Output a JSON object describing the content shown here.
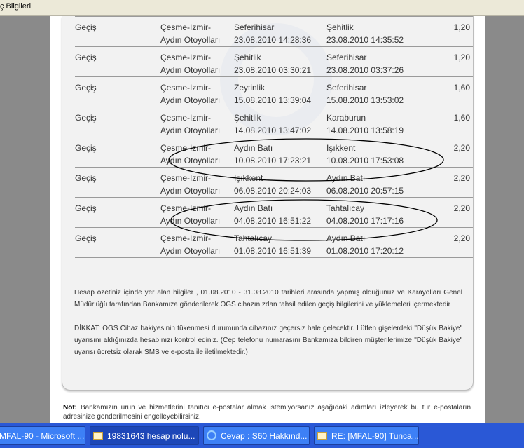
{
  "window": {
    "title": "ç Bilgileri"
  },
  "transactions": [
    {
      "type": "Geçiş",
      "operator_line1": "Çesme-Izmir-",
      "operator_line2": "Aydın Otoyolları",
      "entry_point": "Seferihisar",
      "entry_time": "23.08.2010 14:28:36",
      "exit_point": "Şehitlik",
      "exit_time": "23.08.2010 14:35:52",
      "amount": "1,20"
    },
    {
      "type": "Geçiş",
      "operator_line1": "Çesme-Izmir-",
      "operator_line2": "Aydın Otoyolları",
      "entry_point": "Şehitlik",
      "entry_time": "23.08.2010 03:30:21",
      "exit_point": "Seferihisar",
      "exit_time": "23.08.2010 03:37:26",
      "amount": "1,20"
    },
    {
      "type": "Geçiş",
      "operator_line1": "Çesme-Izmir-",
      "operator_line2": "Aydın Otoyolları",
      "entry_point": "Zeytinlik",
      "entry_time": "15.08.2010 13:39:04",
      "exit_point": "Seferihisar",
      "exit_time": "15.08.2010 13:53:02",
      "amount": "1,60"
    },
    {
      "type": "Geçiş",
      "operator_line1": "Çesme-Izmir-",
      "operator_line2": "Aydın Otoyolları",
      "entry_point": "Şehitlik",
      "entry_time": "14.08.2010 13:47:02",
      "exit_point": "Karaburun",
      "exit_time": "14.08.2010 13:58:19",
      "amount": "1,60"
    },
    {
      "type": "Geçiş",
      "operator_line1": "Çesme-Izmir-",
      "operator_line2": "Aydın Otoyolları",
      "entry_point": "Aydın Batı",
      "entry_time": "10.08.2010 17:23:21",
      "exit_point": "Işıkkent",
      "exit_time": "10.08.2010 17:53:08",
      "amount": "2,20"
    },
    {
      "type": "Geçiş",
      "operator_line1": "Çesme-Izmir-",
      "operator_line2": "Aydın Otoyolları",
      "entry_point": "Işıkkent",
      "entry_time": "06.08.2010 20:24:03",
      "exit_point": "Aydın Batı",
      "exit_time": "06.08.2010 20:57:15",
      "amount": "2,20"
    },
    {
      "type": "Geçiş",
      "operator_line1": "Çesme-Izmir-",
      "operator_line2": "Aydın Otoyolları",
      "entry_point": "Aydın Batı",
      "entry_time": "04.08.2010 16:51:22",
      "exit_point": "Tahtalıcay",
      "exit_time": "04.08.2010 17:17:16",
      "amount": "2,20"
    },
    {
      "type": "Geçiş",
      "operator_line1": "Çesme-Izmir-",
      "operator_line2": "Aydın Otoyolları",
      "entry_point": "Tahtalıcay",
      "entry_time": "01.08.2010 16:51:39",
      "exit_point": "Aydın Batı",
      "exit_time": "01.08.2010 17:20:12",
      "amount": "2,20"
    }
  ],
  "notes": {
    "summary": "Hesap özetiniz içinde yer alan bilgiler , 01.08.2010 - 31.08.2010 tarihleri arasında yapmış olduğunuz ve Karayolları Genel Müdürlüğü tarafından Bankamıza gönderilerek OGS cihazınızdan tahsil edilen geçiş bilgilerini ve yüklemeleri içermektedir",
    "warning": "DİKKAT: OGS Cihaz bakiyesinin tükenmesi durumunda cihazınız geçersiz hale gelecektir. Lütfen gişelerdeki \"Düşük Bakiye\" uyarısını aldığınızda hesabınızı kontrol ediniz. (Cep telefonu numarasını Bankamıza bildiren müşterilerimize \"Düşük Bakiye\" uyarısı ücretsiz olarak SMS ve e-posta ile iletilmektedir.)"
  },
  "bottom_note": {
    "label": "Not:",
    "text": "Bankamızın ürün ve hizmetlerini tanıtıcı e-postalar almak istemiyorsanız aşağıdaki adımları izleyerek bu tür e-postaların adresinize gönderilmesini engelleyebilirsiniz."
  },
  "annotations": {
    "circled_rows": [
      5,
      7
    ],
    "color": "#000000"
  },
  "taskbar": {
    "items": [
      {
        "label": "MFAL-90 - Microsoft ...",
        "icon": "window-icon",
        "active": false
      },
      {
        "label": "19831643 hesap nolu...",
        "icon": "mail-icon",
        "active": true
      },
      {
        "label": "Cevap : S60 Hakkınd...",
        "icon": "ie-icon",
        "active": false
      },
      {
        "label": "RE: [MFAL-90] Tunca...",
        "icon": "mail-icon",
        "active": false
      }
    ]
  }
}
